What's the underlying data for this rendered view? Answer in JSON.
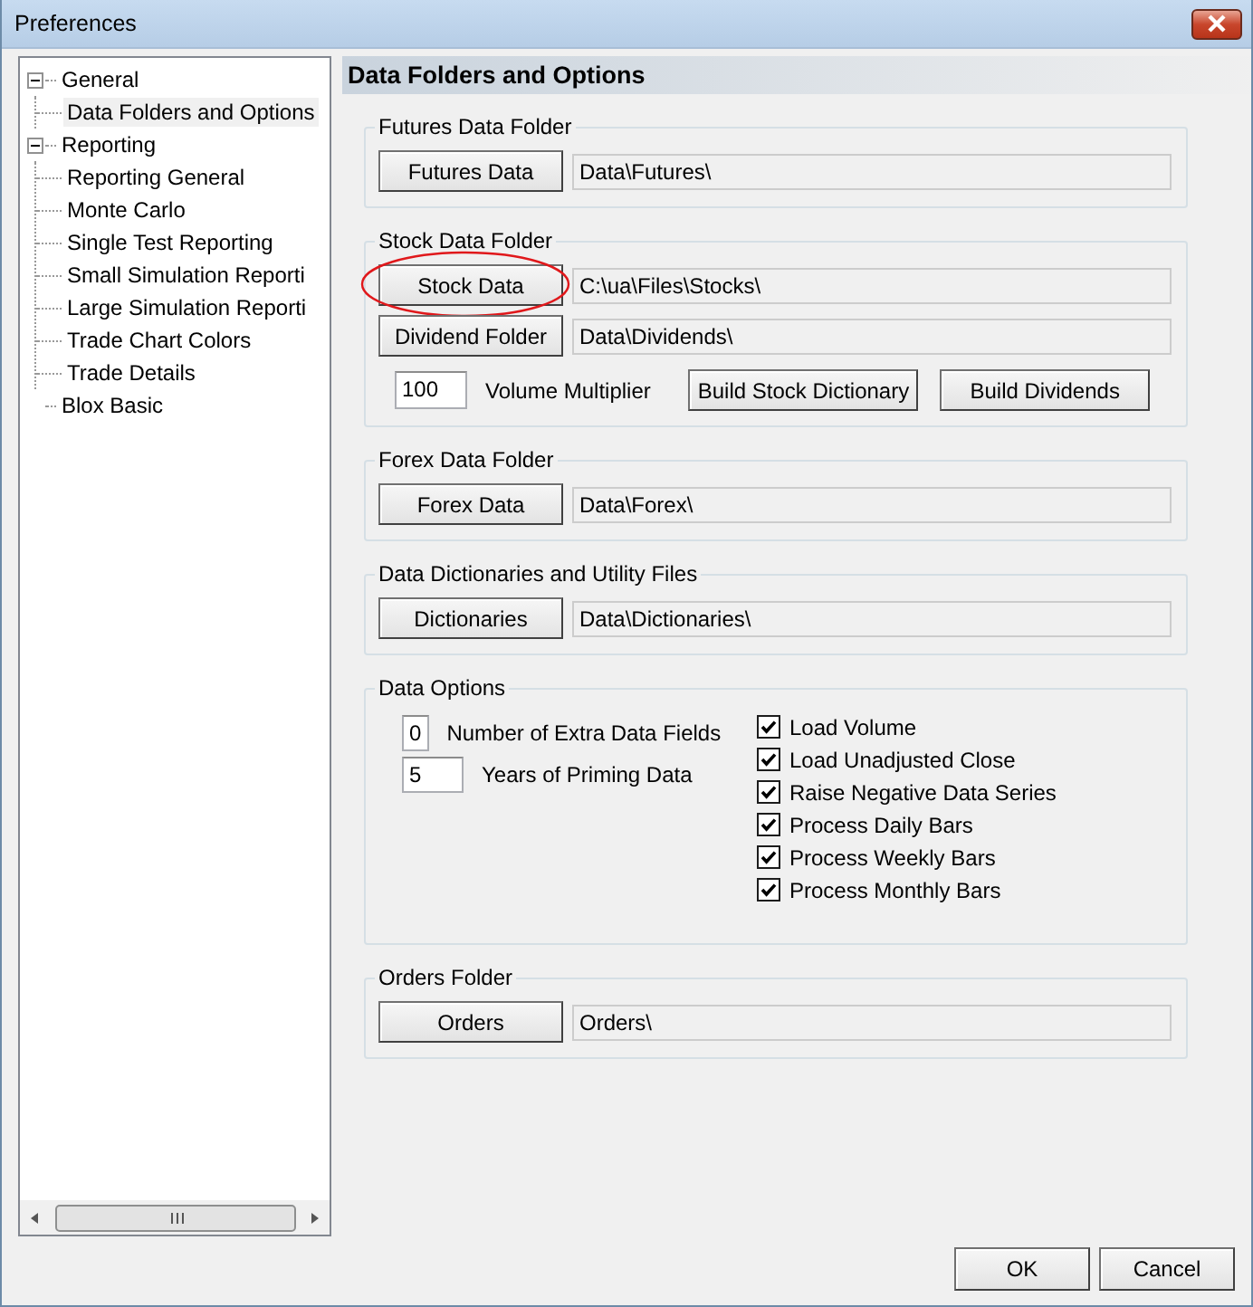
{
  "window": {
    "title": "Preferences"
  },
  "tree": [
    {
      "label": "General",
      "expanded": true,
      "selected": false,
      "children": [
        {
          "label": "Data Folders and Options",
          "selected": true
        }
      ]
    },
    {
      "label": "Reporting",
      "expanded": true,
      "selected": false,
      "children": [
        {
          "label": "Reporting General",
          "selected": false
        },
        {
          "label": "Monte Carlo",
          "selected": false
        },
        {
          "label": "Single Test Reporting",
          "selected": false
        },
        {
          "label": "Small Simulation Reporti",
          "selected": false
        },
        {
          "label": "Large Simulation Reporti",
          "selected": false
        },
        {
          "label": "Trade Chart Colors",
          "selected": false
        },
        {
          "label": "Trade Details",
          "selected": false
        }
      ]
    },
    {
      "label": "Blox Basic",
      "selected": false
    }
  ],
  "page_title": "Data Folders and Options",
  "groups": [
    {
      "title": "Futures Data Folder",
      "kind": "folders",
      "rows": [
        {
          "button": "Futures Data",
          "path": "Data\\Futures\\",
          "circled": false
        }
      ]
    },
    {
      "title": "Stock Data Folder",
      "kind": "folders",
      "rows": [
        {
          "button": "Stock Data",
          "path": "C:\\ua\\Files\\Stocks\\",
          "circled": true
        },
        {
          "button": "Dividend Folder",
          "path": "Data\\Dividends\\",
          "circled": false
        }
      ],
      "extra": {
        "value": "100",
        "label": "Volume Multiplier",
        "buttons": [
          "Build Stock Dictionary",
          "Build Dividends"
        ]
      }
    },
    {
      "title": "Forex Data Folder",
      "kind": "folders",
      "rows": [
        {
          "button": "Forex Data",
          "path": "Data\\Forex\\",
          "circled": false
        }
      ]
    },
    {
      "title": "Data Dictionaries and Utility Files",
      "kind": "folders",
      "rows": [
        {
          "button": "Dictionaries",
          "path": "Data\\Dictionaries\\",
          "circled": false
        }
      ]
    },
    {
      "title": "Data Options",
      "kind": "options",
      "fields": [
        {
          "value": "0",
          "label": "Number of Extra Data Fields"
        },
        {
          "value": "5",
          "label": "Years of Priming Data"
        }
      ],
      "checks": [
        {
          "label": "Load Volume",
          "checked": true
        },
        {
          "label": "Load Unadjusted Close",
          "checked": true
        },
        {
          "label": "Raise Negative Data Series",
          "checked": true
        },
        {
          "label": "Process Daily Bars",
          "checked": true
        },
        {
          "label": "Process Weekly Bars",
          "checked": true
        },
        {
          "label": "Process Monthly Bars",
          "checked": true
        }
      ]
    },
    {
      "title": "Orders Folder",
      "kind": "folders",
      "rows": [
        {
          "button": "Orders",
          "path": "Orders\\",
          "circled": false
        }
      ]
    }
  ],
  "buttons": [
    "OK",
    "Cancel"
  ]
}
